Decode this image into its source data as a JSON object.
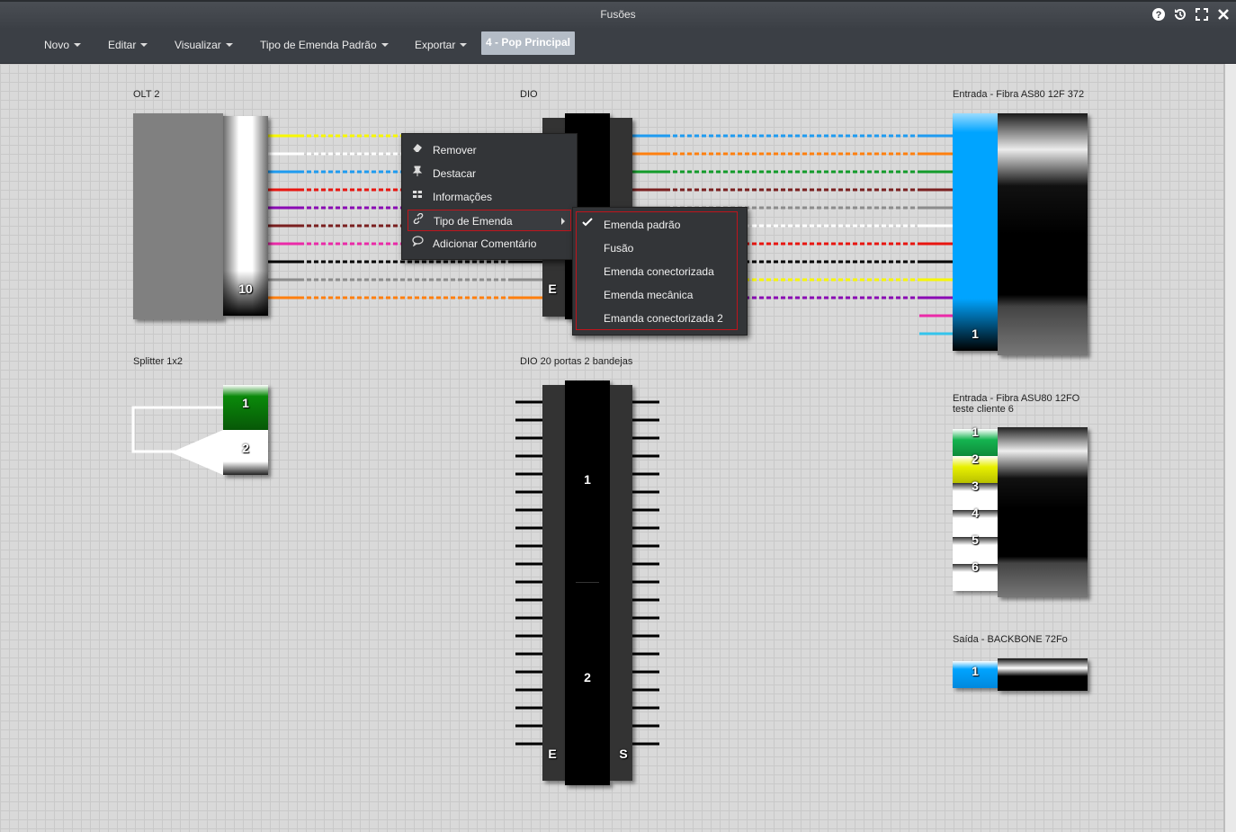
{
  "window": {
    "title": "Fusões"
  },
  "titlebar_icons": [
    "help-icon",
    "history-icon",
    "fullscreen-icon",
    "close-icon"
  ],
  "menubar": {
    "items": [
      {
        "label": "Novo"
      },
      {
        "label": "Editar"
      },
      {
        "label": "Visualizar"
      },
      {
        "label": "Tipo de Emenda Padrão"
      },
      {
        "label": "Exportar"
      }
    ],
    "active_pop": "4 - Pop Principal"
  },
  "elements": {
    "olt": {
      "label": "OLT 2",
      "port": "10"
    },
    "dio": {
      "label": "DIO",
      "side_e": "E"
    },
    "entrada1": {
      "label": "Entrada - Fibra AS80 12F 372",
      "tube": "1"
    },
    "splitter": {
      "label": "Splitter 1x2",
      "out1": "1",
      "out2": "2"
    },
    "dio20": {
      "label": "DIO 20 portas 2 bandejas",
      "tray1": "1",
      "tray2": "2",
      "side_e": "E",
      "side_s": "S"
    },
    "entrada2": {
      "label": "Entrada - Fibra ASU80 12FO teste cliente 6",
      "fibers": [
        "1",
        "2",
        "3",
        "4",
        "5",
        "6"
      ]
    },
    "saida": {
      "label": "Saída - BACKBONE 72Fo",
      "tube": "1"
    }
  },
  "colors": {
    "fiber_left": [
      "#f7f700",
      "#ffffff",
      "#1e9bf0",
      "#e8150f",
      "#8a0ab4",
      "#7a2020",
      "#ea2aa8",
      "#000000",
      "#8c8c8c",
      "#ff7f0e"
    ],
    "fiber_right": [
      "#1e9bf0",
      "#ff7f0e",
      "#139b2a",
      "#7a2020",
      "#8c8c8c",
      "#ffffff",
      "#e8150f",
      "#000000",
      "#f7f700",
      "#8a0ab4",
      "#ea2aa8",
      "#33c4ec"
    ],
    "accent_menu_border": "#c0141c"
  },
  "context_menu": {
    "items": [
      {
        "label": "Remover",
        "icon": "eraser-icon"
      },
      {
        "label": "Destacar",
        "icon": "pin-icon"
      },
      {
        "label": "Informações",
        "icon": "info-icon"
      },
      {
        "label": "Tipo de Emenda",
        "icon": "link-icon",
        "submenu": true
      },
      {
        "label": "Adicionar Comentário",
        "icon": "comment-icon"
      }
    ]
  },
  "submenu": {
    "items": [
      {
        "label": "Emenda padrão",
        "checked": true
      },
      {
        "label": "Fusão"
      },
      {
        "label": "Emenda conectorizada"
      },
      {
        "label": "Emenda mecânica"
      },
      {
        "label": "Emanda conectorizada 2"
      }
    ]
  }
}
